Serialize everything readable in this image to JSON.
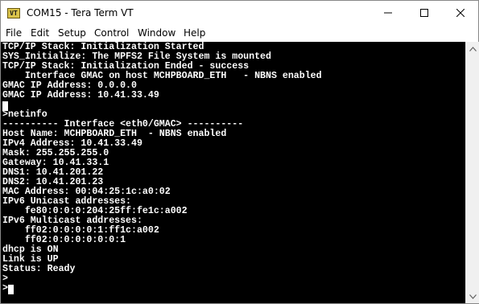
{
  "window": {
    "title": "COM15 - Tera Term VT",
    "icon": "teraterm-icon"
  },
  "menu": [
    "File",
    "Edit",
    "Setup",
    "Control",
    "Window",
    "Help"
  ],
  "terminal": {
    "lines": [
      "TCP/IP Stack: Initialization Started",
      "SYS_Initialize: The MPFS2 File System is mounted",
      "TCP/IP Stack: Initialization Ended - success",
      "    Interface GMAC on host MCHPBOARD_ETH   - NBNS enabled",
      "GMAC IP Address: 0.0.0.0",
      "GMAC IP Address: 10.41.33.49",
      "",
      ">netinfo",
      "---------- Interface <eth0/GMAC> ----------",
      "Host Name: MCHPBOARD_ETH  - NBNS enabled",
      "IPv4 Address: 10.41.33.49",
      "Mask: 255.255.255.0",
      "Gateway: 10.41.33.1",
      "DNS1: 10.41.201.22",
      "DNS2: 10.41.201.23",
      "MAC Address: 00:04:25:1c:a0:02",
      "IPv6 Unicast addresses:",
      "    fe80:0:0:0:204:25ff:fe1c:a002",
      "IPv6 Multicast addresses:",
      "    ff02:0:0:0:0:1:ff1c:a002",
      "    ff02:0:0:0:0:0:0:1",
      "dhcp is ON",
      "Link is UP",
      "Status: Ready",
      ">",
      ">"
    ]
  }
}
